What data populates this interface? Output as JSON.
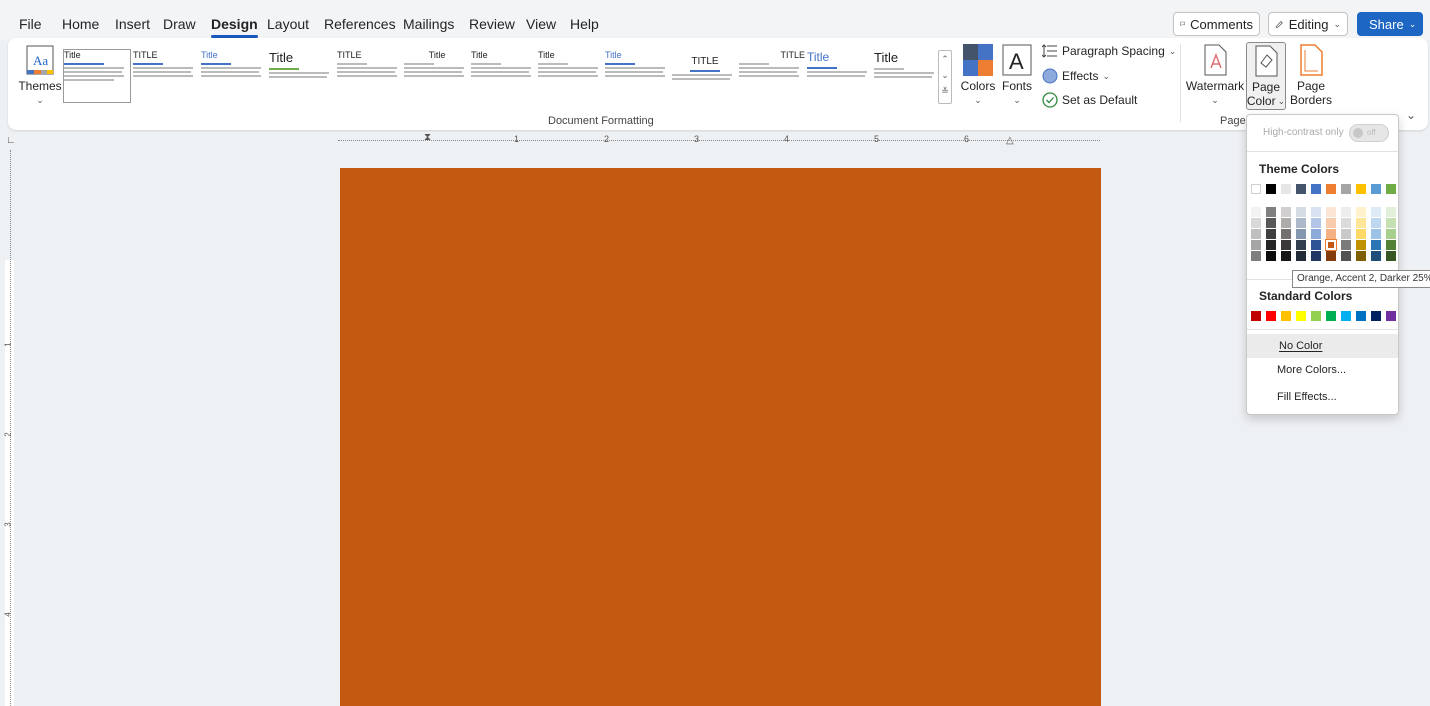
{
  "menu": {
    "items": [
      "File",
      "Home",
      "Insert",
      "Draw",
      "Design",
      "Layout",
      "References",
      "Mailings",
      "Review",
      "View",
      "Help"
    ],
    "active": "Design"
  },
  "top_buttons": {
    "comments": "Comments",
    "editing": "Editing",
    "share": "Share"
  },
  "ribbon": {
    "themes_label": "Themes",
    "style_set_titles": [
      "Title",
      "TITLE",
      "Title",
      "Title",
      "TITLE",
      "Title",
      "Title",
      "Title",
      "Title",
      "TITLE",
      "TITLE",
      "Title",
      "Title"
    ],
    "document_formatting_label": "Document Formatting",
    "colors_label": "Colors",
    "fonts_label": "Fonts",
    "paragraph_spacing_label": "Paragraph Spacing",
    "effects_label": "Effects",
    "set_as_default_label": "Set as Default",
    "watermark_label": "Watermark",
    "page_color_line1": "Page",
    "page_color_line2": "Color",
    "page_borders_line1": "Page",
    "page_borders_line2": "Borders",
    "page_group_label": "Page"
  },
  "ruler": {
    "numbers": [
      "1",
      "2",
      "3",
      "4",
      "5",
      "6"
    ]
  },
  "document": {
    "page_color": "#C45911"
  },
  "page_color_dropdown": {
    "high_contrast_label": "High-contrast only",
    "toggle_state": "off",
    "theme_colors_heading": "Theme Colors",
    "theme_colors": [
      "#FFFFFF",
      "#000000",
      "#E7E6E6",
      "#44546A",
      "#4472C4",
      "#ED7D31",
      "#A5A5A5",
      "#FFC000",
      "#5B9BD5",
      "#70AD47"
    ],
    "theme_shades": [
      [
        "#F2F2F2",
        "#7F7F7F",
        "#D0CECE",
        "#D6DCE4",
        "#D9E2F3",
        "#FBE5D5",
        "#EDEDED",
        "#FFF2CC",
        "#DEEBF6",
        "#E2EFD9"
      ],
      [
        "#D8D8D8",
        "#595959",
        "#AEABAB",
        "#ADB9CA",
        "#B4C6E7",
        "#F7CBAC",
        "#DBDBDB",
        "#FFE598",
        "#BDD7EE",
        "#C5E0B3"
      ],
      [
        "#BFBFBF",
        "#3F3F3F",
        "#757070",
        "#8496B0",
        "#8EAADB",
        "#F4B183",
        "#C9C9C9",
        "#FFD965",
        "#9CC3E5",
        "#A8D08D"
      ],
      [
        "#A5A5A5",
        "#262626",
        "#3A3838",
        "#323F4F",
        "#2F5496",
        "#C45911",
        "#7B7B7B",
        "#BF9000",
        "#2E75B5",
        "#538135"
      ],
      [
        "#7F7F7F",
        "#0C0C0C",
        "#171616",
        "#222A35",
        "#1F3864",
        "#833C0B",
        "#525252",
        "#7F6000",
        "#1E4E79",
        "#375623"
      ]
    ],
    "standard_colors_heading": "Standard Colors",
    "standard_colors": [
      "#C00000",
      "#FF0000",
      "#FFC000",
      "#FFFF00",
      "#92D050",
      "#00B050",
      "#00B0F0",
      "#0070C0",
      "#002060",
      "#7030A0"
    ],
    "no_color_label": "No Color",
    "more_colors_label": "More Colors...",
    "fill_effects_label": "Fill Effects...",
    "tooltip": "Orange, Accent 2, Darker 25%"
  }
}
